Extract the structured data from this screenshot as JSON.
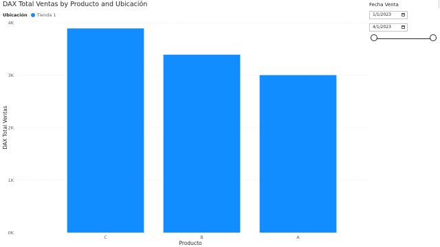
{
  "chart_data": {
    "type": "bar",
    "title": "DAX Total Ventas by Producto and Ubicación",
    "xlabel": "Producto",
    "ylabel": "DAX Total Ventas",
    "categories": [
      "C",
      "B",
      "A"
    ],
    "series": [
      {
        "name": "Tienda 1",
        "values": [
          3890,
          3390,
          3000
        ],
        "color": "#118dff"
      }
    ],
    "ylim": [
      0,
      4000
    ],
    "yticks": [
      0,
      1000,
      2000,
      3000,
      4000
    ],
    "ytick_labels": [
      "0K",
      "1K",
      "2K",
      "3K",
      "4K"
    ],
    "grid": true,
    "legend": {
      "title": "Ubicación",
      "placement": "top-left"
    }
  },
  "slicer": {
    "title": "Fecha Venta",
    "start_date": "1/1/2023",
    "end_date": "4/1/2023",
    "calendar_icon": "calendar-icon"
  }
}
